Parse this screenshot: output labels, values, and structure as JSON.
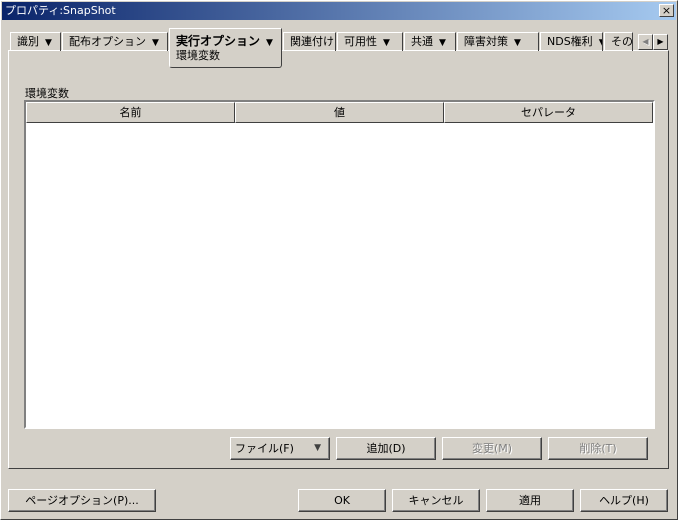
{
  "window": {
    "title": "プロパティ:SnapShot",
    "close": "×"
  },
  "tabs": [
    {
      "label": "識別",
      "arrow": "▼"
    },
    {
      "label": "配布オプション",
      "arrow": "▼"
    },
    {
      "label": "実行オプション",
      "arrow": "▼",
      "sub": "環境変数"
    },
    {
      "label": "関連付け"
    },
    {
      "label": "可用性",
      "arrow": "▼"
    },
    {
      "label": "共通",
      "arrow": "▼"
    },
    {
      "label": "障害対策",
      "arrow": "▼"
    },
    {
      "label": "NDS権利",
      "arrow": "▼"
    },
    {
      "label": "その"
    }
  ],
  "section": {
    "label": "環境変数",
    "columns": [
      "名前",
      "値",
      "セパレータ"
    ]
  },
  "actions": {
    "file": "ファイル(F)",
    "file_arrow": "▼",
    "add": "追加(D)",
    "modify": "変更(M)",
    "delete": "削除(T)"
  },
  "footer": {
    "page_options": "ページオプション(P)...",
    "ok": "OK",
    "cancel": "キャンセル",
    "apply": "適用",
    "help": "ヘルプ(H)"
  }
}
